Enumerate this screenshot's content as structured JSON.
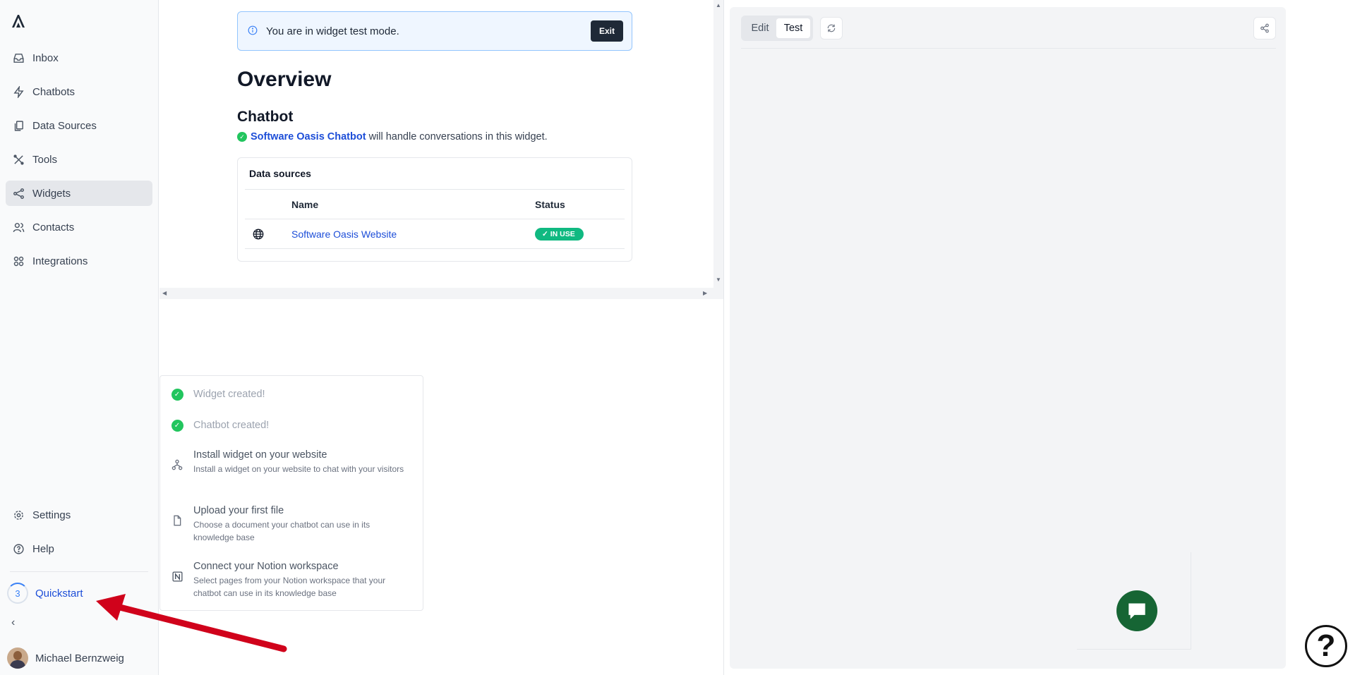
{
  "sidebar": {
    "items": [
      {
        "label": "Inbox",
        "icon": "inbox-icon"
      },
      {
        "label": "Chatbots",
        "icon": "bolt-icon"
      },
      {
        "label": "Data Sources",
        "icon": "documents-icon"
      },
      {
        "label": "Tools",
        "icon": "tools-icon"
      },
      {
        "label": "Widgets",
        "icon": "widget-icon",
        "active": true
      },
      {
        "label": "Contacts",
        "icon": "users-icon"
      },
      {
        "label": "Integrations",
        "icon": "grid-icon"
      }
    ],
    "settings": "Settings",
    "help": "Help",
    "quickstart": {
      "label": "Quickstart",
      "count": "3"
    },
    "user_name": "Michael Bernzweig"
  },
  "main": {
    "banner_text": "You are in widget test mode.",
    "exit_label": "Exit",
    "title": "Overview",
    "chatbot_heading": "Chatbot",
    "chatbot_link": "Software Oasis Chatbot",
    "chatbot_suffix": "will handle conversations in this widget.",
    "data_sources": {
      "title": "Data sources",
      "columns": [
        "Name",
        "Status"
      ],
      "rows": [
        {
          "name": "Software Oasis Website",
          "status": "IN USE"
        }
      ]
    }
  },
  "quickstart_panel": {
    "done": [
      "Widget created!",
      "Chatbot created!"
    ],
    "steps": [
      {
        "title": "Install widget on your website",
        "desc": "Install a widget on your website to chat with your visitors"
      },
      {
        "title": "Upload your first file",
        "desc": "Choose a document your chatbot can use in its knowledge base"
      },
      {
        "title": "Connect your Notion workspace",
        "desc": "Select pages from your Notion workspace that your chatbot can use in its knowledge base"
      }
    ]
  },
  "preview": {
    "edit_label": "Edit",
    "test_label": "Test"
  },
  "colors": {
    "accent": "#1d4ed8",
    "success": "#10b981",
    "launcher": "#166534",
    "annotation": "#d0021b"
  }
}
